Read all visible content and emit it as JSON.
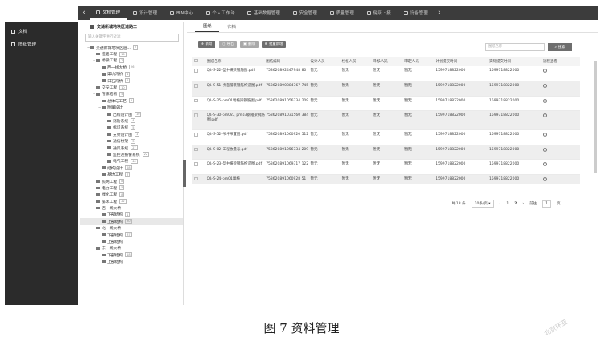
{
  "topnav": {
    "items": [
      {
        "label": "文档管理",
        "active": true
      },
      {
        "label": "设计管理"
      },
      {
        "label": "BIM中心"
      },
      {
        "label": "个人工作台"
      },
      {
        "label": "基础数据管理"
      },
      {
        "label": "安全管理"
      },
      {
        "label": "质量管理"
      },
      {
        "label": "健康上报"
      },
      {
        "label": "设备管理"
      }
    ],
    "prev_arrow": "‹",
    "next_arrow": "›"
  },
  "leftnav": {
    "items": [
      {
        "label": "文档",
        "icon": "document-icon"
      },
      {
        "label": "图纸管理",
        "icon": "drawing-icon"
      }
    ]
  },
  "tree": {
    "title": "交通新城地块区道路工",
    "search_placeholder": "输入关键字进行过滤",
    "nodes": [
      {
        "label": "交通新城地块区道...",
        "count": "2",
        "toggle": "−",
        "depth": 0
      },
      {
        "label": "道路工程",
        "count": "16",
        "toggle": "",
        "depth": 1
      },
      {
        "label": "桥梁工程",
        "count": "2",
        "toggle": "−",
        "depth": 1
      },
      {
        "label": "西一线大桥",
        "count": "26",
        "toggle": "",
        "depth": 2
      },
      {
        "label": "渠坑沟桥",
        "count": "1",
        "toggle": "",
        "depth": 2
      },
      {
        "label": "日石沟桥",
        "count": "1",
        "toggle": "",
        "depth": 2
      },
      {
        "label": "交安工程",
        "count": "10",
        "toggle": "",
        "depth": 1
      },
      {
        "label": "管廊结构",
        "count": "5",
        "toggle": "−",
        "depth": 1
      },
      {
        "label": "总体与工艺",
        "count": "5",
        "toggle": "",
        "depth": 2
      },
      {
        "label": "附属设计",
        "count": "",
        "toggle": "−",
        "depth": 2
      },
      {
        "label": "出线设计图",
        "count": "10",
        "toggle": "",
        "depth": 3
      },
      {
        "label": "消防系统",
        "count": "4",
        "toggle": "",
        "depth": 3
      },
      {
        "label": "标识系统",
        "count": "5",
        "toggle": "",
        "depth": 3
      },
      {
        "label": "支架设计图",
        "count": "1",
        "toggle": "",
        "depth": 3
      },
      {
        "label": "通信桥架",
        "count": "3",
        "toggle": "",
        "depth": 3
      },
      {
        "label": "通风系统",
        "count": "27",
        "toggle": "",
        "depth": 3
      },
      {
        "label": "监控及报警系统",
        "count": "22",
        "toggle": "",
        "depth": 3
      },
      {
        "label": "电气工程",
        "count": "46",
        "toggle": "",
        "depth": 3
      },
      {
        "label": "结构设计",
        "count": "28",
        "toggle": "",
        "depth": 2
      },
      {
        "label": "基坑工程",
        "count": "7",
        "toggle": "",
        "depth": 2
      },
      {
        "label": "照明工程",
        "count": "8",
        "toggle": "",
        "depth": 1
      },
      {
        "label": "电力工程",
        "count": "5",
        "toggle": "",
        "depth": 1
      },
      {
        "label": "绿化工程",
        "count": "8",
        "toggle": "",
        "depth": 1
      },
      {
        "label": "排水工程",
        "count": "22",
        "toggle": "",
        "depth": 1
      },
      {
        "label": "西一线大桥",
        "count": "",
        "toggle": "−",
        "depth": 1
      },
      {
        "label": "下部结构",
        "count": "1",
        "toggle": "",
        "depth": 2
      },
      {
        "label": "上部结构",
        "count": "30",
        "toggle": "",
        "depth": 2,
        "selected": true
      },
      {
        "label": "北一线大桥",
        "count": "",
        "toggle": "−",
        "depth": 1
      },
      {
        "label": "下部结构",
        "count": "37",
        "toggle": "",
        "depth": 2
      },
      {
        "label": "上部结构",
        "count": "",
        "toggle": "",
        "depth": 2
      },
      {
        "label": "东一线大桥",
        "count": "",
        "toggle": "−",
        "depth": 1
      },
      {
        "label": "下部结构",
        "count": "18",
        "toggle": "",
        "depth": 2
      },
      {
        "label": "上部结构",
        "count": "",
        "toggle": "",
        "depth": 2
      }
    ]
  },
  "main": {
    "tabs": [
      {
        "label": "图纸",
        "active": true
      },
      {
        "label": "归档"
      }
    ],
    "toolbar": [
      {
        "label": "新增",
        "icon": "plus-icon",
        "disabled": false
      },
      {
        "label": "导出",
        "icon": "export-icon",
        "disabled": true
      },
      {
        "label": "删除",
        "icon": "trash-icon",
        "disabled": true
      },
      {
        "label": "批量新增",
        "icon": "plus-icon",
        "disabled": false
      }
    ],
    "search_placeholder": "图纸名称",
    "search_button": "搜索",
    "columns": [
      "图纸名称",
      "图纸编码",
      "设计人员",
      "校核人员",
      "审核人员",
      "审定人员",
      "计划提交时间",
      "实际提交时间",
      "流程查看"
    ],
    "rows": [
      {
        "name": "QL-S-22-型中横梁钢筋图.pdf",
        "code": "753620892447948 80",
        "designer": "暂无",
        "checker": "暂无",
        "reviewer": "暂无",
        "approver": "暂无",
        "plan": "1599718822000",
        "actual": "1599718822000"
      },
      {
        "name": "QL-S-51-桥面铺装钢筋构造图.pdf",
        "code": "753620890884767 745",
        "designer": "暂无",
        "checker": "暂无",
        "reviewer": "暂无",
        "approver": "暂无",
        "plan": "1599718822000",
        "actual": "1599718822000"
      },
      {
        "name": "QL-S-25-pm01端横梁钢筋图.pdf",
        "code": "753620891056734 209",
        "designer": "暂无",
        "checker": "暂无",
        "reviewer": "暂无",
        "approver": "暂无",
        "plan": "1599718822000",
        "actual": "1599718822000"
      },
      {
        "name": "QL-S-30-pm02、pm03钢箱梁钢筋图.pdf",
        "code": "753620891031560 384",
        "designer": "暂无",
        "checker": "暂无",
        "reviewer": "暂无",
        "approver": "暂无",
        "plan": "1599718822000",
        "actual": "1599718822000"
      },
      {
        "name": "QL-S-52-吊杆布置图.pdf",
        "code": "753620891060920 512",
        "designer": "暂无",
        "checker": "暂无",
        "reviewer": "暂无",
        "approver": "暂无",
        "plan": "1599718822000",
        "actual": "1599718822000"
      },
      {
        "name": "QL-S-02-工程数量表.pdf",
        "code": "753620891056734 209",
        "designer": "暂无",
        "checker": "暂无",
        "reviewer": "暂无",
        "approver": "暂无",
        "plan": "1599718822000",
        "actual": "1599718822000"
      },
      {
        "name": "QL-S-23-型中横梁钢筋构造图.pdf",
        "code": "753620891069317 122",
        "designer": "暂无",
        "checker": "暂无",
        "reviewer": "暂无",
        "approver": "暂无",
        "plan": "1599718822000",
        "actual": "1599718822000"
      },
      {
        "name": "QL-S-24-pm01端横",
        "code": "753620891060928 51",
        "designer": "暂无",
        "checker": "暂无",
        "reviewer": "暂无",
        "approver": "暂无",
        "plan": "1599718822000",
        "actual": "1599718822000"
      }
    ],
    "pager": {
      "total": "共 18 条",
      "per_page": "10条/页",
      "prev": "‹",
      "pages": [
        "1",
        "2"
      ],
      "next": "›",
      "goto_label": "前往",
      "goto_value": "1",
      "page_suffix": "页"
    }
  },
  "caption": "图 7   资料管理",
  "watermark": "北京环亚"
}
